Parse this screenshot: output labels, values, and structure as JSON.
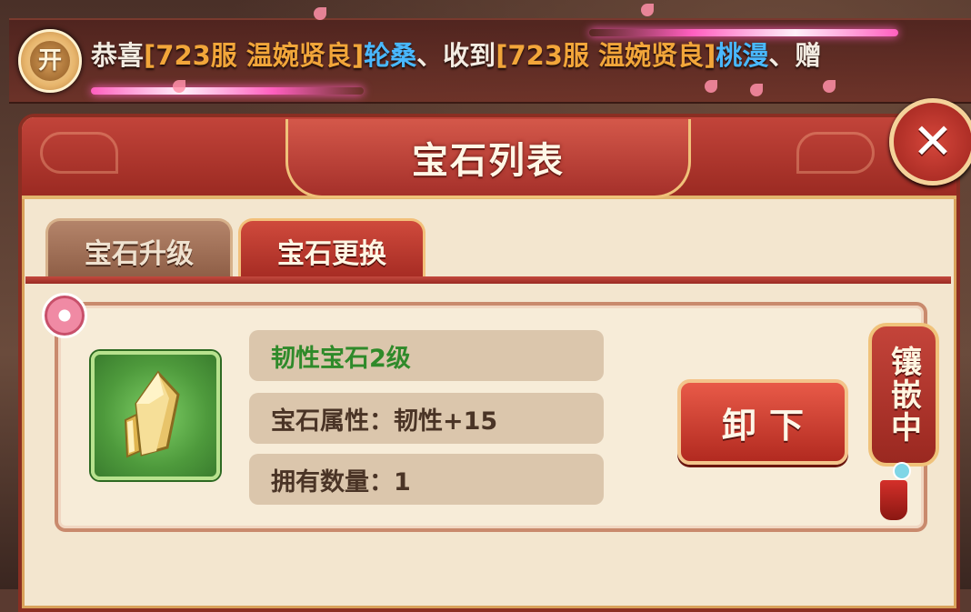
{
  "banner": {
    "badge": "开",
    "segments": [
      {
        "text": "恭喜",
        "color": "white"
      },
      {
        "text": "[723服 温婉贤良]",
        "color": "orange"
      },
      {
        "text": "轮桑",
        "color": "blue"
      },
      {
        "text": "、收到",
        "color": "white"
      },
      {
        "text": "[723服 温婉贤良]",
        "color": "orange"
      },
      {
        "text": "桃漫",
        "color": "blue"
      },
      {
        "text": "、赠",
        "color": "white"
      }
    ]
  },
  "panel": {
    "title": "宝石列表",
    "close_label": "✕"
  },
  "tabs": [
    {
      "label": "宝石升级",
      "active": false
    },
    {
      "label": "宝石更换",
      "active": true
    }
  ],
  "gem": {
    "icon": "yellow-crystal-gem-icon",
    "name": "韧性宝石2级",
    "attribute": "宝石属性：韧性+15",
    "quantity": "拥有数量：1",
    "action_label": "卸下",
    "status": "镶嵌中"
  },
  "colors": {
    "accent_red": "#b22a20",
    "gold_border": "#f0c27a",
    "gem_name_green": "#2f8a2a",
    "player_orange": "#f2a63a",
    "player_blue": "#49b8ff"
  }
}
